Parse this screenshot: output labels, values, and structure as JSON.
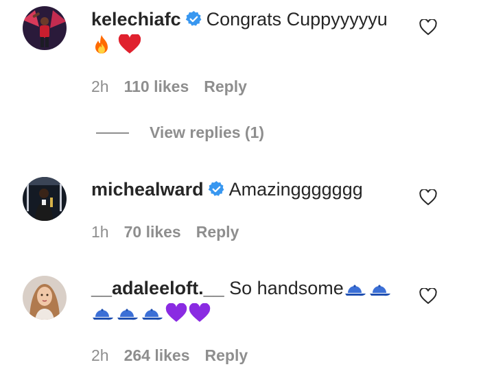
{
  "comments": [
    {
      "username": "kelechiafc",
      "verified": true,
      "text": "Congrats Cuppyyyyyu",
      "emojis": [
        "fire",
        "red-heart"
      ],
      "time": "2h",
      "likes": "110 likes",
      "reply": "Reply",
      "view_replies": "View replies (1)"
    },
    {
      "username": "michealward",
      "verified": true,
      "text": "Amazinggggggg",
      "time": "1h",
      "likes": "70 likes",
      "reply": "Reply"
    },
    {
      "username": "__adaleeloft.__",
      "verified": false,
      "text": "So handsome",
      "emojis": [
        "billed-cap",
        "billed-cap",
        "billed-cap",
        "billed-cap",
        "billed-cap",
        "purple-heart",
        "purple-heart"
      ],
      "time": "2h",
      "likes": "264 likes",
      "reply": "Reply"
    }
  ],
  "colors": {
    "text": "#262626",
    "meta": "#8e8e8e",
    "verified": "#3897f0",
    "fire": "#ff6a00",
    "red_heart": "#e0212e",
    "purple_heart": "#8a2be2",
    "cap": "#3b6fd6"
  }
}
